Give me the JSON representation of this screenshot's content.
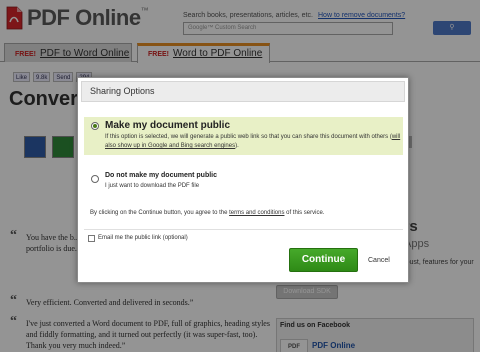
{
  "site": {
    "logo_text": "PDF Online",
    "logo_mark": "™"
  },
  "search": {
    "hint": "Search books, presentations, articles, etc.",
    "remove_link": "How to remove documents?",
    "placeholder": "Google™ Custom Search"
  },
  "tabs": [
    {
      "badge": "FREE!",
      "label": "PDF to Word Online"
    },
    {
      "badge": "FREE!",
      "label": "Word to PDF Online"
    }
  ],
  "social": [
    "Like",
    "9.8k",
    "Send",
    "294"
  ],
  "page": {
    "heading": "Convert"
  },
  "testimonials": [
    {
      "quote_mark": "“",
      "text": "You have the b... spent 4 days at... tools. What a h... them, I have a ... portfolio is due... me from failing..."
    },
    {
      "quote_mark": "“",
      "text": "Very efficient. Converted and delivered in seconds.”"
    },
    {
      "quote_mark": "“",
      "text": "I've just converted a Word document to PDF, full of graphics, heading styles and fiddly formatting, and it turned out perfectly (it was super-fast, too). Thank you very much indeed.”"
    }
  ],
  "sidebar": {
    "heading": "pers",
    "subheading": "Apps",
    "text": "ement robust, features for your",
    "download_sdk": "Download SDK",
    "facebook_title": "Find us on Facebook",
    "facebook_logo": "PDF",
    "facebook_page": "PDF Online"
  },
  "modal": {
    "title": "Sharing Options",
    "option_public": {
      "title": "Make my document public",
      "desc_prefix": "If this option is selected, we will generate a public web link so that you can share this document with others (",
      "desc_link": "will also show up in Google and Bing search engines",
      "desc_suffix": ").",
      "selected": true
    },
    "option_private": {
      "title": "Do not make my document public",
      "desc": "I just want to download the PDF file",
      "selected": false
    },
    "terms_prefix": "By clicking on the Continue button, you agree to the ",
    "terms_link": "terms and conditions",
    "terms_suffix": " of this service.",
    "email_label": "Email me the public link (optional)",
    "email_checked": false,
    "continue_label": "Continue",
    "cancel_label": "Cancel"
  },
  "colors": {
    "overlay": "rgba(0,0,0,0.42)",
    "continue_button": "#3a9a1f",
    "selected_option_bg": "#e8f0c6",
    "tab_accent": "#e98f24",
    "link": "#2255bb"
  },
  "icons": {
    "logo": "pdf-logo-icon",
    "word_file": "word-file-icon",
    "excel_file": "excel-file-icon"
  }
}
